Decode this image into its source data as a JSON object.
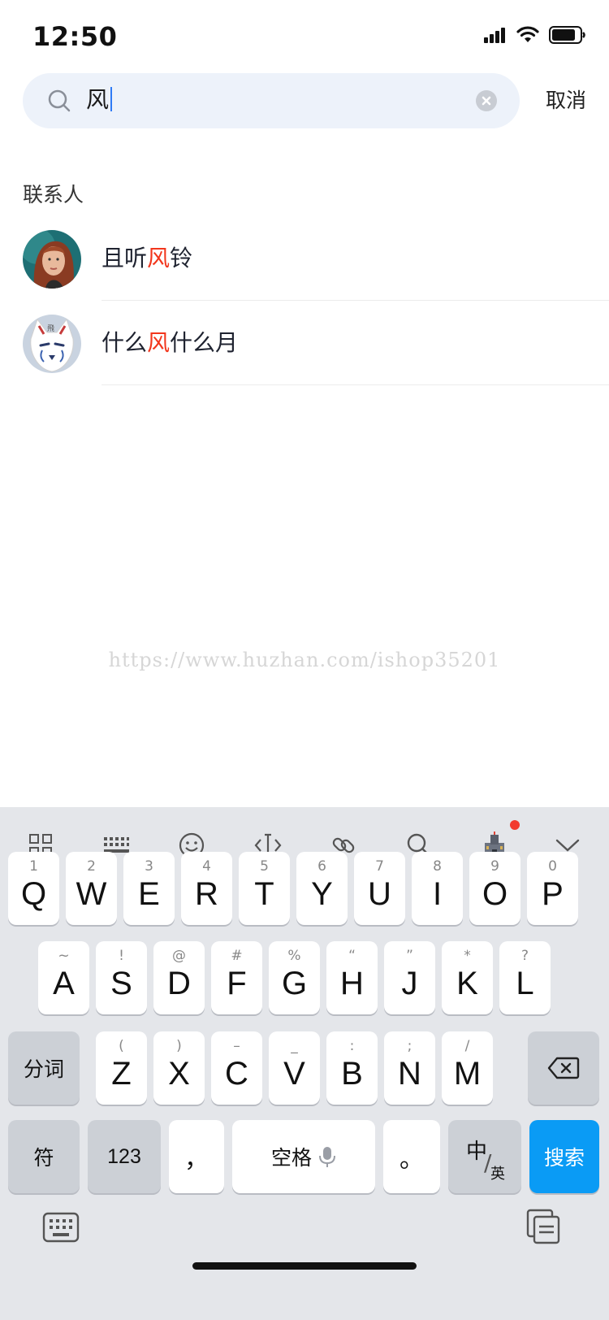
{
  "status_bar": {
    "time": "12:50"
  },
  "search": {
    "value": "风",
    "cancel_label": "取消"
  },
  "section": {
    "title": "联系人"
  },
  "contacts": [
    {
      "name_before": "且听",
      "name_match": "风",
      "name_after": "铃"
    },
    {
      "name_before": "什么",
      "name_match": "风",
      "name_after": "什么月"
    }
  ],
  "watermark": "https://www.huzhan.com/ishop35201",
  "colors": {
    "highlight": "#f2361c",
    "search_bg": "#edf2fa",
    "keyboard_bg": "#e4e6ea",
    "action_key": "#0a9bf5"
  },
  "keyboard": {
    "toolbar_icons": [
      "grid-icon",
      "keyboard-layout-icon",
      "emoji-icon",
      "cursor-icon",
      "link-icon",
      "search-icon",
      "castle-icon",
      "chevron-down-icon"
    ],
    "row1": [
      {
        "sub": "1",
        "key": "Q"
      },
      {
        "sub": "2",
        "key": "W"
      },
      {
        "sub": "3",
        "key": "E"
      },
      {
        "sub": "4",
        "key": "R"
      },
      {
        "sub": "5",
        "key": "T"
      },
      {
        "sub": "6",
        "key": "Y"
      },
      {
        "sub": "7",
        "key": "U"
      },
      {
        "sub": "8",
        "key": "I"
      },
      {
        "sub": "9",
        "key": "O"
      },
      {
        "sub": "0",
        "key": "P"
      }
    ],
    "row2": [
      {
        "sub": "~",
        "key": "A"
      },
      {
        "sub": "!",
        "key": "S"
      },
      {
        "sub": "@",
        "key": "D"
      },
      {
        "sub": "#",
        "key": "F"
      },
      {
        "sub": "%",
        "key": "G"
      },
      {
        "sub": "“",
        "key": "H"
      },
      {
        "sub": "”",
        "key": "J"
      },
      {
        "sub": "*",
        "key": "K"
      },
      {
        "sub": "?",
        "key": "L"
      }
    ],
    "row3": [
      {
        "sub": "(",
        "key": "Z"
      },
      {
        "sub": ")",
        "key": "X"
      },
      {
        "sub": "–",
        "key": "C"
      },
      {
        "sub": "_",
        "key": "V"
      },
      {
        "sub": ":",
        "key": "B"
      },
      {
        "sub": ";",
        "key": "N"
      },
      {
        "sub": "/",
        "key": "M"
      }
    ],
    "segment_label": "分词",
    "symbols_label": "符",
    "numbers_label": "123",
    "comma_label": "，",
    "space_label": "空格",
    "period_label": "。",
    "lang_main": "中",
    "lang_sub": "英",
    "action_label": "搜索"
  }
}
